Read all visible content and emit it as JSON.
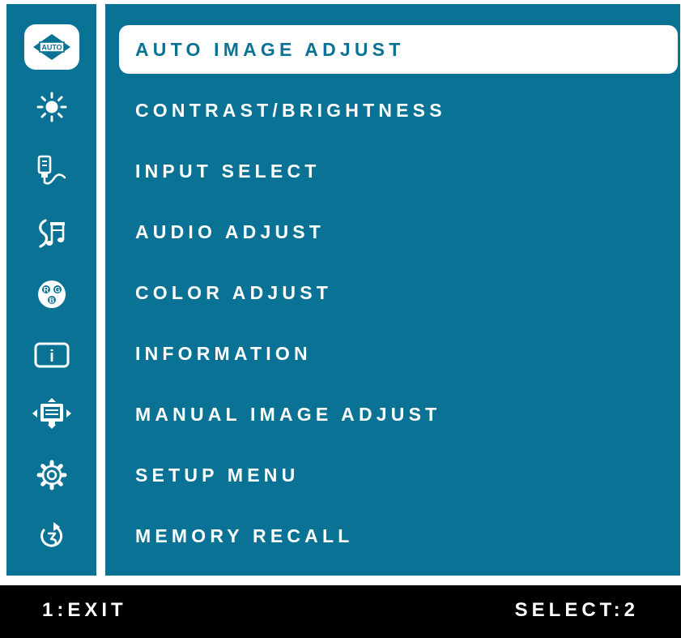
{
  "colors": {
    "panel": "#0a7395",
    "highlight": "#ffffff",
    "text": "#ffffff",
    "bottom_bar": "#000000"
  },
  "icons": [
    {
      "name": "auto-adjust-icon",
      "label": "AUTO"
    },
    {
      "name": "brightness-icon"
    },
    {
      "name": "input-select-icon"
    },
    {
      "name": "audio-icon"
    },
    {
      "name": "color-rgb-icon",
      "letters": [
        "R",
        "G",
        "B"
      ]
    },
    {
      "name": "information-icon",
      "letter": "i"
    },
    {
      "name": "manual-image-icon"
    },
    {
      "name": "setup-gear-icon"
    },
    {
      "name": "memory-recall-icon"
    }
  ],
  "menu": {
    "items": [
      {
        "id": "auto-image-adjust",
        "label": "AUTO IMAGE ADJUST",
        "selected": true
      },
      {
        "id": "contrast-brightness",
        "label": "CONTRAST/BRIGHTNESS",
        "selected": false
      },
      {
        "id": "input-select",
        "label": "INPUT SELECT",
        "selected": false
      },
      {
        "id": "audio-adjust",
        "label": "AUDIO ADJUST",
        "selected": false
      },
      {
        "id": "color-adjust",
        "label": "COLOR ADJUST",
        "selected": false
      },
      {
        "id": "information",
        "label": "INFORMATION",
        "selected": false
      },
      {
        "id": "manual-image-adjust",
        "label": "MANUAL IMAGE ADJUST",
        "selected": false
      },
      {
        "id": "setup-menu",
        "label": "SETUP MENU",
        "selected": false
      },
      {
        "id": "memory-recall",
        "label": "MEMORY RECALL",
        "selected": false
      }
    ]
  },
  "footer": {
    "exit_hint": "1:EXIT",
    "select_hint": "SELECT:2"
  }
}
